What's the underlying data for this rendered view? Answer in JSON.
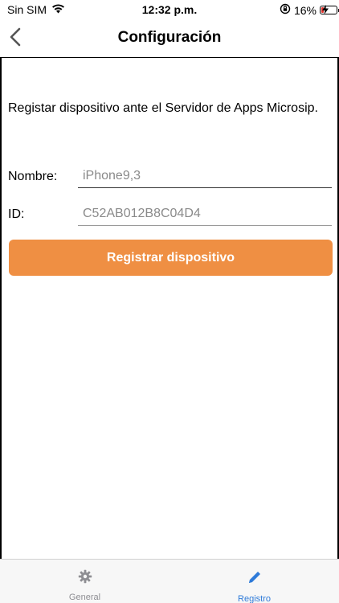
{
  "status_bar": {
    "carrier": "Sin SIM",
    "time": "12:32 p.m.",
    "battery_percent": "16%",
    "battery_level": 0.16,
    "icons": [
      "wifi-icon",
      "orientation-lock-icon",
      "battery-icon",
      "charging-icon"
    ]
  },
  "nav": {
    "title": "Configuración",
    "back_icon": "chevron-left-icon"
  },
  "main": {
    "intro_text": "Registar dispositivo ante el Servidor de Apps Microsip.",
    "fields": [
      {
        "label": "Nombre:",
        "value": "iPhone9,3"
      },
      {
        "label": "ID:",
        "value": "C52AB012B8C04D4"
      }
    ],
    "register_button_label": "Registrar dispositivo"
  },
  "tab_bar": {
    "tabs": [
      {
        "label": "General",
        "icon": "gear-icon",
        "active": false
      },
      {
        "label": "Registro",
        "icon": "pencil-icon",
        "active": true
      }
    ]
  },
  "colors": {
    "accent_orange": "#ef8f43",
    "active_tab_blue": "#2f7bd9",
    "inactive_tab_gray": "#8e8e93",
    "battery_red": "#e0302a"
  }
}
